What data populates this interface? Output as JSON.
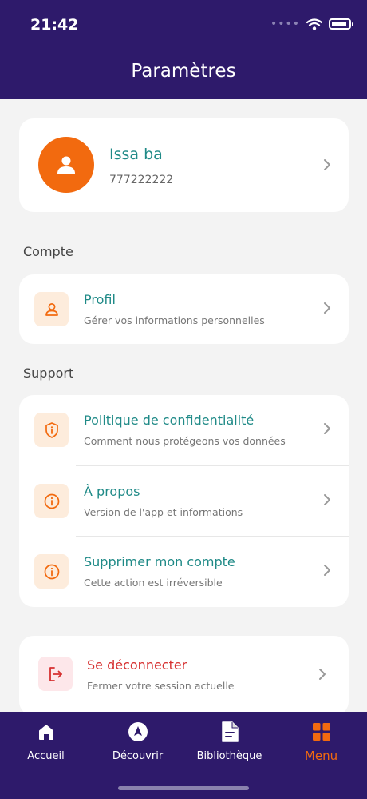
{
  "status": {
    "time": "21:42"
  },
  "header": {
    "title": "Paramètres"
  },
  "profile": {
    "name": "Issa ba",
    "phone": "777222222"
  },
  "sections": {
    "account": {
      "label": "Compte",
      "items": [
        {
          "title": "Profil",
          "subtitle": "Gérer vos informations personnelles",
          "icon": "user-icon"
        }
      ]
    },
    "support": {
      "label": "Support",
      "items": [
        {
          "title": "Politique de confidentialité",
          "subtitle": "Comment nous protégeons vos données",
          "icon": "shield-icon"
        },
        {
          "title": "À propos",
          "subtitle": "Version de l'app et informations",
          "icon": "info-icon"
        },
        {
          "title": "Supprimer mon compte",
          "subtitle": "Cette action est irréversible",
          "icon": "info-icon"
        }
      ]
    }
  },
  "logout": {
    "title": "Se déconnecter",
    "subtitle": "Fermer votre session actuelle",
    "icon": "logout-icon"
  },
  "tabbar": {
    "tabs": [
      {
        "label": "Accueil",
        "icon": "home-icon"
      },
      {
        "label": "Découvrir",
        "icon": "compass-icon"
      },
      {
        "label": "Bibliothèque",
        "icon": "document-icon"
      },
      {
        "label": "Menu",
        "icon": "grid-icon",
        "active": true
      }
    ]
  },
  "colors": {
    "header": "#2e1a6b",
    "accent": "#f26a0f",
    "teal": "#1f8a87",
    "danger": "#d63030"
  }
}
